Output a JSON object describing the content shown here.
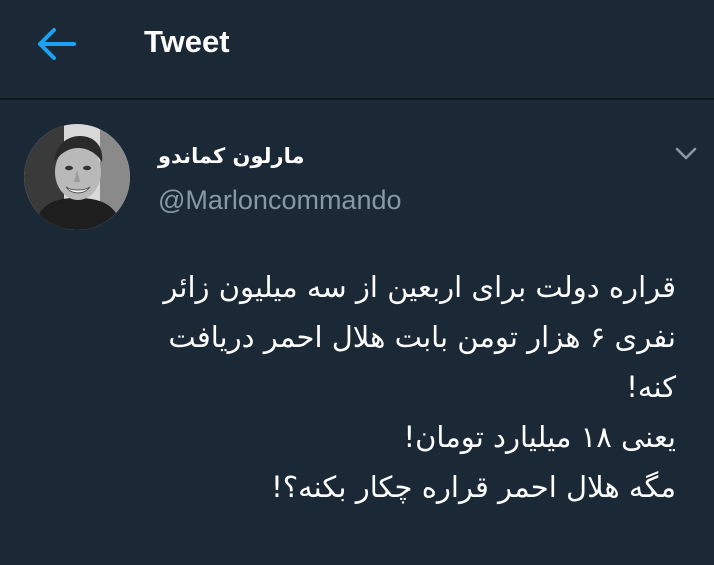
{
  "header": {
    "title": "Tweet",
    "back_icon": "arrow-left-icon",
    "accent_color": "#1da1f2"
  },
  "tweet": {
    "author": {
      "display_name": "مارلون کماندو",
      "username": "@Marloncommando",
      "avatar_icon": "profile-photo"
    },
    "menu_icon": "chevron-down-icon",
    "text_lines": [
      "قراره دولت برای اربعین از سه میلیون زائر",
      "نفری ۶ هزار تومن بابت هلال احمر دریافت",
      "کنه!",
      "یعنی ۱۸ میلیارد تومان!",
      "مگه هلال احمر قراره چکار بکنه؟!"
    ]
  },
  "colors": {
    "background": "#1b2836",
    "divider": "#10171e",
    "secondary_text": "#8899a6",
    "primary_text": "#ffffff"
  }
}
